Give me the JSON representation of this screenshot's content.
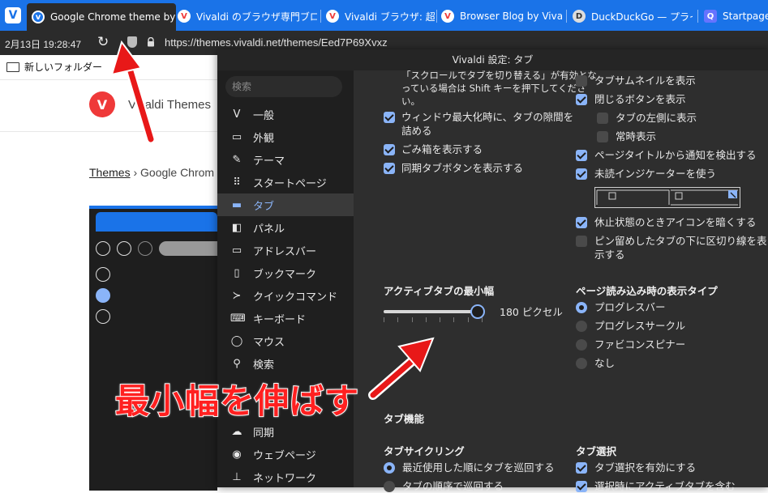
{
  "browser": {
    "tabs": [
      {
        "label": "Google Chrome theme by F",
        "favicon": "vivaldi-badge-icon",
        "active": true
      },
      {
        "label": "Vivaldi のブラウザ専門ブロ",
        "favicon": "vivaldi-icon"
      },
      {
        "label": "Vivaldi ブラウザ: 超絶便利",
        "favicon": "vivaldi-icon"
      },
      {
        "label": "Browser Blog by Vivaldi",
        "favicon": "vivaldi-icon"
      },
      {
        "label": "DuckDuckGo — プライバ",
        "favicon": "duckduckgo-icon"
      },
      {
        "label": "Startpage —",
        "favicon": "startpage-icon"
      }
    ],
    "clock": "2月13日  19:28:47",
    "url": "https://themes.vivaldi.net/themes/Eed7P69Xvxz",
    "bookmark_folder": "新しいフォルダー",
    "accent_color": "#1a73e8"
  },
  "page": {
    "site_title": "Vivaldi Themes",
    "breadcrumb_link": "Themes",
    "breadcrumb_sep": "›",
    "breadcrumb_current": "Google Chrom"
  },
  "settings": {
    "window_title": "Vivaldi 設定: タブ",
    "search_placeholder": "検索",
    "nav": [
      {
        "label": "一般",
        "icon": "vivaldi-icon"
      },
      {
        "label": "外観",
        "icon": "window-icon"
      },
      {
        "label": "テーマ",
        "icon": "brush-icon"
      },
      {
        "label": "スタートページ",
        "icon": "grid-icon"
      },
      {
        "label": "タブ",
        "icon": "tab-icon",
        "selected": true
      },
      {
        "label": "パネル",
        "icon": "panel-icon"
      },
      {
        "label": "アドレスバー",
        "icon": "address-bar-icon"
      },
      {
        "label": "ブックマーク",
        "icon": "bookmark-icon"
      },
      {
        "label": "クイックコマンド",
        "icon": "quick-command-icon"
      },
      {
        "label": "キーボード",
        "icon": "keyboard-icon"
      },
      {
        "label": "マウス",
        "icon": "mouse-icon"
      },
      {
        "label": "検索",
        "icon": "search-icon"
      },
      {
        "label": "同期",
        "icon": "cloud-icon"
      },
      {
        "label": "ウェブページ",
        "icon": "globe-icon"
      },
      {
        "label": "ネットワーク",
        "icon": "network-icon"
      }
    ],
    "left_col": {
      "note_line1": "「スクロールでタブを切り替える」が有効とな",
      "note_line2": "っている場合は Shift キーを押下してくださ",
      "note_line3": "い。",
      "options": [
        {
          "label_line1": "ウィンドウ最大化時に、タブの隙間を",
          "label_line2": "詰める",
          "checked": true
        },
        {
          "label_line1": "ごみ箱を表示する",
          "checked": true
        },
        {
          "label_line1": "同期タブボタンを表示する",
          "checked": true
        }
      ],
      "min_width_heading": "アクティブタブの最小幅",
      "min_width_value": "180 ピクセル",
      "min_width_fraction": 0.95
    },
    "right_col": {
      "options": [
        {
          "label": "タブサムネイルを表示",
          "checked": false
        },
        {
          "label": "閉じるボタンを表示",
          "checked": true
        },
        {
          "label": "タブの左側に表示",
          "checked": false
        },
        {
          "label": "常時表示",
          "checked": false
        },
        {
          "label": "ページタイトルから通知を検出する",
          "checked": true
        },
        {
          "label": "未読インジケーターを使う",
          "checked": true
        },
        {
          "label": "休止状態のときアイコンを暗くする",
          "checked": true
        },
        {
          "label_line1": "ピン留めしたタブの下に区切り線を表",
          "label_line2": "示する",
          "checked": false
        }
      ],
      "load_heading": "ページ読み込み時の表示タイプ",
      "load_types": [
        {
          "label": "プログレスバー",
          "selected": true
        },
        {
          "label": "プログレスサークル",
          "selected": false
        },
        {
          "label": "ファビコンスピナー",
          "selected": false
        },
        {
          "label": "なし",
          "selected": false
        }
      ]
    },
    "features_heading": "タブ機能",
    "cycling_heading": "タブサイクリング",
    "cycling_options": [
      {
        "label": "最近使用した順にタブを巡回する",
        "selected": true
      },
      {
        "label": "タブの順序で巡回する",
        "selected": false
      }
    ],
    "selection_heading": "タブ選択",
    "selection_options": [
      {
        "label": "タブ選択を有効にする",
        "checked": true
      },
      {
        "label": "選択時にアクティブタブを含む",
        "checked": true
      }
    ]
  },
  "annotation": {
    "text": "最小幅を伸ばす",
    "color": "#ff2020"
  }
}
